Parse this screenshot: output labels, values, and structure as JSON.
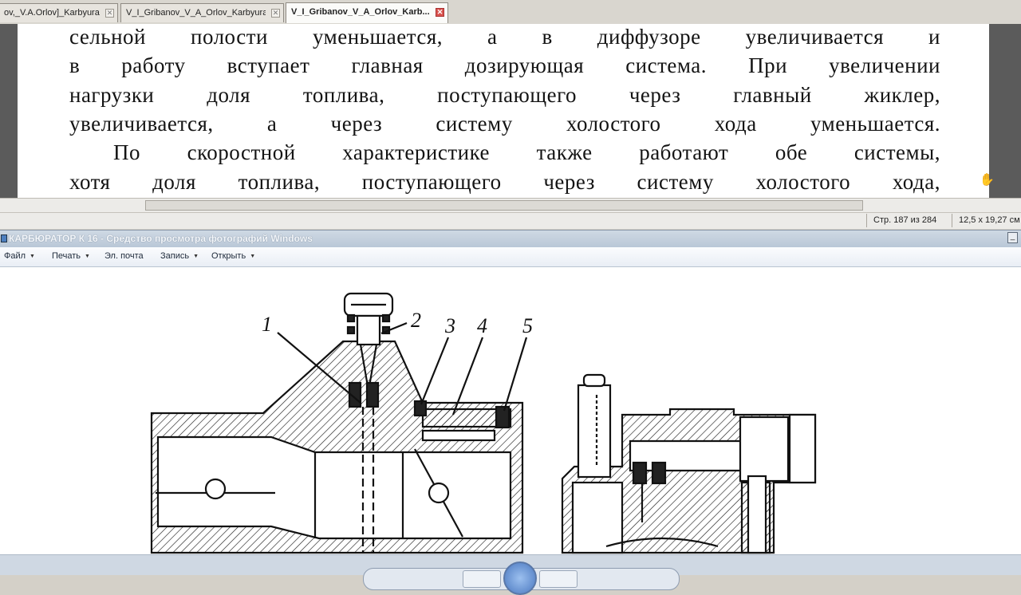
{
  "tabs": [
    {
      "label": "ov,_V.A.Orlov]_Karbyura..."
    },
    {
      "label": "V_I_Gribanov_V_A_Orlov_Karbyurat..."
    },
    {
      "label": "V_I_Gribanov_V_A_Orlov_Karb..."
    }
  ],
  "tab_close_glyph": "✕",
  "document": {
    "lines": [
      "сельной полости уменьшается, а в диффузоре увеличивается и",
      "в работу вступает главная дозирующая система. При увеличении",
      "нагрузки доля топлива, поступающего через главный жиклер,",
      "увеличивается, а через систему холостого хода уменьшается.",
      "По скоростной характеристике также работают обе системы,",
      "хотя доля топлива, поступающего через систему холостого хода,"
    ],
    "cursor_icon": "hand-cursor-icon"
  },
  "status": {
    "page_info": "Стр. 187 из 284",
    "page_size": "12,5 x 19,27 см"
  },
  "photo_viewer": {
    "title": "КАРБЮРАТОР К 16 - Средство просмотра фотографий Windows",
    "minimize_glyph": "_",
    "menu": {
      "file": "Файл",
      "print": "Печать",
      "email": "Эл. почта",
      "record": "Запись",
      "open": "Открыть"
    },
    "caret": "▼",
    "diagram_labels": [
      "1",
      "2",
      "3",
      "4",
      "5"
    ]
  }
}
